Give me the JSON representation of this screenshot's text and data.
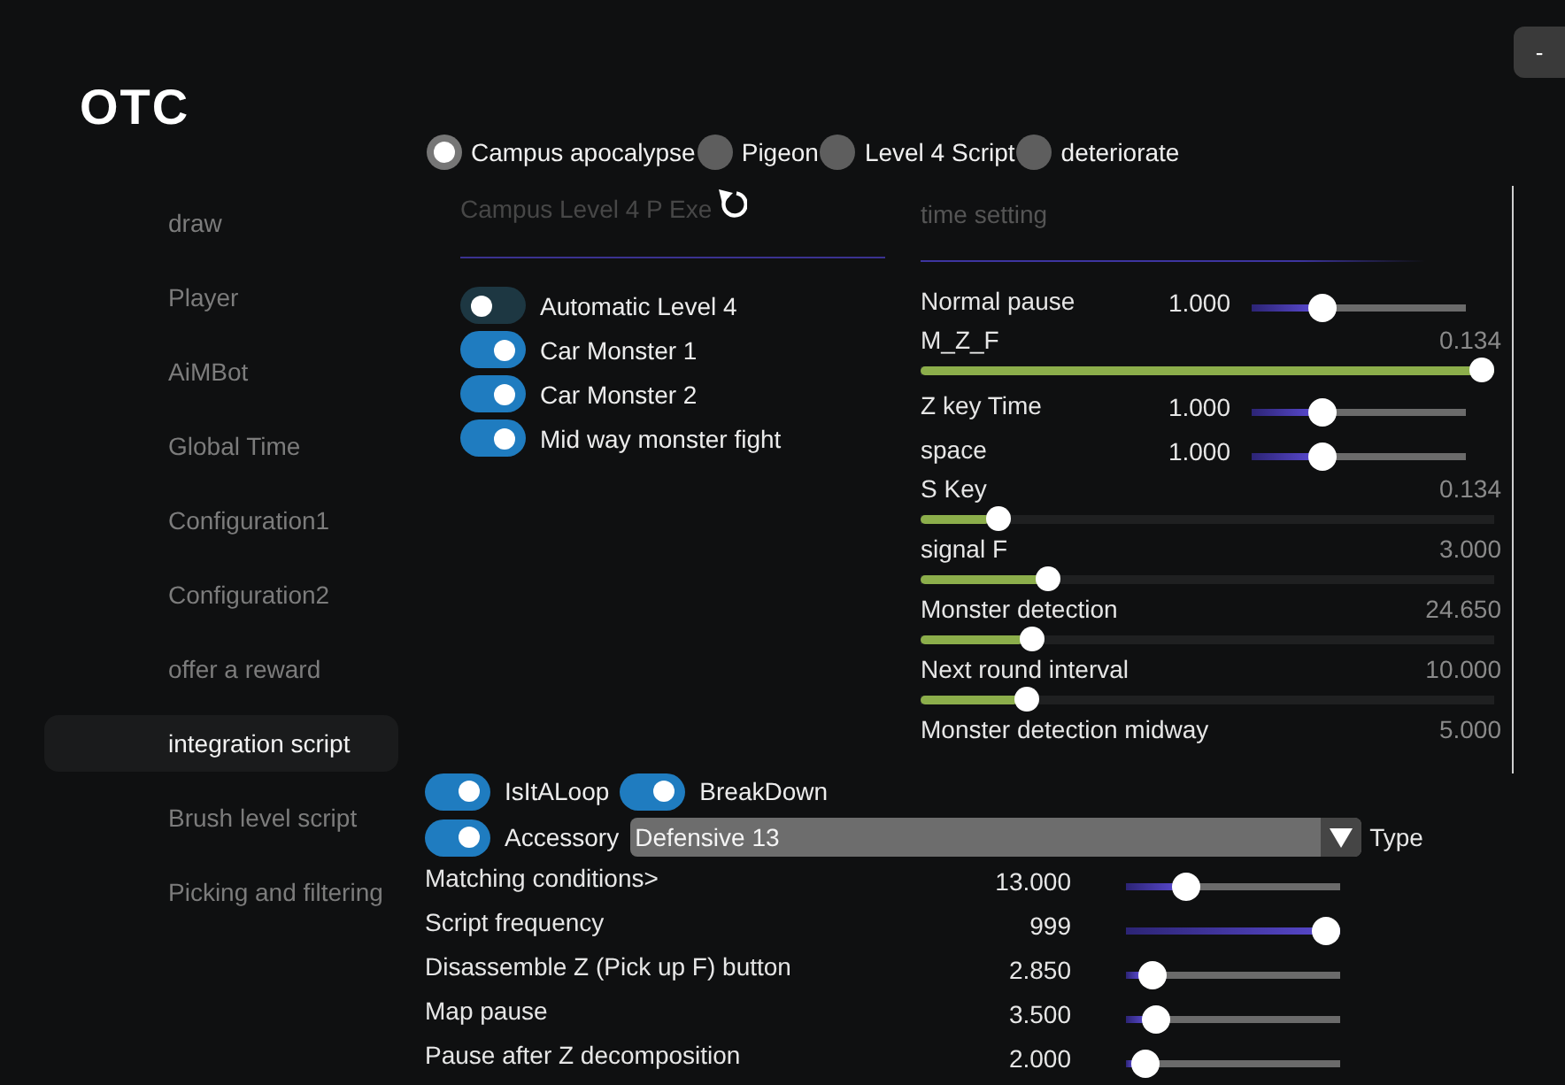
{
  "logo": {
    "text": "OTC"
  },
  "window_buttons": [
    {
      "label": "-"
    }
  ],
  "sidebar": {
    "items": [
      {
        "label": "draw",
        "selected": false
      },
      {
        "label": "Player",
        "selected": false
      },
      {
        "label": "AiMBot",
        "selected": false
      },
      {
        "label": "Global Time",
        "selected": false
      },
      {
        "label": "Configuration1",
        "selected": false
      },
      {
        "label": "Configuration2",
        "selected": false
      },
      {
        "label": "offer a reward",
        "selected": false
      },
      {
        "label": "integration script",
        "selected": true
      },
      {
        "label": "Brush level script",
        "selected": false
      },
      {
        "label": "Picking and filtering",
        "selected": false
      }
    ]
  },
  "script_tabs": [
    {
      "label": "Campus apocalypse",
      "selected": true
    },
    {
      "label": "Pigeon",
      "selected": false
    },
    {
      "label": "Level 4 Script",
      "selected": false
    },
    {
      "label": "deteriorate",
      "selected": false
    }
  ],
  "level4_panel": {
    "title": "Campus Level 4 P Exe",
    "toggles": [
      {
        "label": "Automatic Level 4",
        "on": false
      },
      {
        "label": "Car Monster 1",
        "on": true
      },
      {
        "label": "Car Monster 2",
        "on": true
      },
      {
        "label": "Mid way monster fight",
        "on": true
      }
    ]
  },
  "time_panel": {
    "title": "time setting",
    "rows": [
      {
        "kind": "compact",
        "label": "Normal pause",
        "reading": "1.000",
        "level": 0.3
      },
      {
        "kind": "wide",
        "label": "M_Z_F",
        "reading": "0.134",
        "level": 1
      },
      {
        "kind": "compact",
        "label": "Z key Time",
        "reading": "1.000",
        "level": 0.3
      },
      {
        "kind": "compact",
        "label": "space",
        "reading": "1.000",
        "level": 0.3
      },
      {
        "kind": "wide",
        "label": "S Key",
        "reading": "0.134",
        "level": 0.12
      },
      {
        "kind": "wide",
        "label": "signal F",
        "reading": "3.000",
        "level": 0.21
      },
      {
        "kind": "wide",
        "label": "Monster detection",
        "reading": "24.650",
        "level": 0.18
      },
      {
        "kind": "wide",
        "label": "Next round interval",
        "reading": "10.000",
        "level": 0.17
      },
      {
        "kind": "wide",
        "label": "Monster detection midway",
        "reading": "5.000"
      }
    ]
  },
  "script_panel": {
    "toggles": [
      {
        "label": "IsItALoop",
        "on": true
      },
      {
        "label": "BreakDown",
        "on": true
      },
      {
        "label": "Accessory",
        "on": true
      }
    ],
    "type_select": {
      "value": "Defensive 13",
      "label": "Type"
    },
    "sliders": [
      {
        "label": "Matching conditions>",
        "reading": "13.000",
        "level": 0.25
      },
      {
        "label": "Script frequency",
        "reading": "999",
        "level": 1
      },
      {
        "label": "Disassemble Z (Pick up F) button",
        "reading": "2.850",
        "level": 0.07
      },
      {
        "label": "Map pause",
        "reading": "3.500",
        "level": 0.09
      },
      {
        "label": "Pause after Z decomposition",
        "reading": "2.000",
        "level": 0.03
      }
    ]
  }
}
